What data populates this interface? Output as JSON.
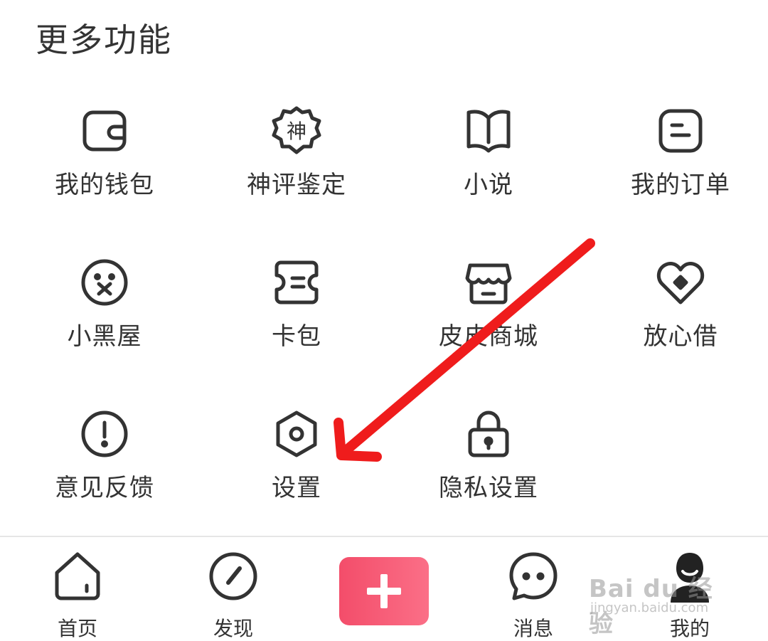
{
  "section": {
    "title": "更多功能"
  },
  "grid": {
    "rows": [
      [
        {
          "label": "我的钱包",
          "icon": "wallet-icon"
        },
        {
          "label": "神评鉴定",
          "icon": "shen-badge-icon",
          "icon_text": "神"
        },
        {
          "label": "小说",
          "icon": "book-icon"
        },
        {
          "label": "我的订单",
          "icon": "order-icon"
        }
      ],
      [
        {
          "label": "小黑屋",
          "icon": "muted-face-icon"
        },
        {
          "label": "卡包",
          "icon": "ticket-icon"
        },
        {
          "label": "皮皮商城",
          "icon": "store-icon"
        },
        {
          "label": "放心借",
          "icon": "heart-coin-icon"
        }
      ],
      [
        {
          "label": "意见反馈",
          "icon": "feedback-alert-icon"
        },
        {
          "label": "设置",
          "icon": "settings-hexagon-icon"
        },
        {
          "label": "隐私设置",
          "icon": "lock-icon"
        }
      ]
    ]
  },
  "tabbar": {
    "items": [
      {
        "label": "首页",
        "icon": "home-icon"
      },
      {
        "label": "发现",
        "icon": "compass-icon"
      },
      {
        "label": "",
        "icon": "plus-icon"
      },
      {
        "label": "消息",
        "icon": "chat-bubble-icon"
      },
      {
        "label": "我的",
        "icon": "avatar-icon"
      }
    ],
    "publish_color": "#f34d6a"
  },
  "annotation": {
    "arrow_color": "#ef1c1c",
    "target": "设置"
  },
  "watermark": {
    "main": "Bai du 经验",
    "sub": "jingyan.baidu.com"
  },
  "colors": {
    "text": "#333333",
    "background": "#ffffff",
    "divider": "#e6e6e6"
  }
}
